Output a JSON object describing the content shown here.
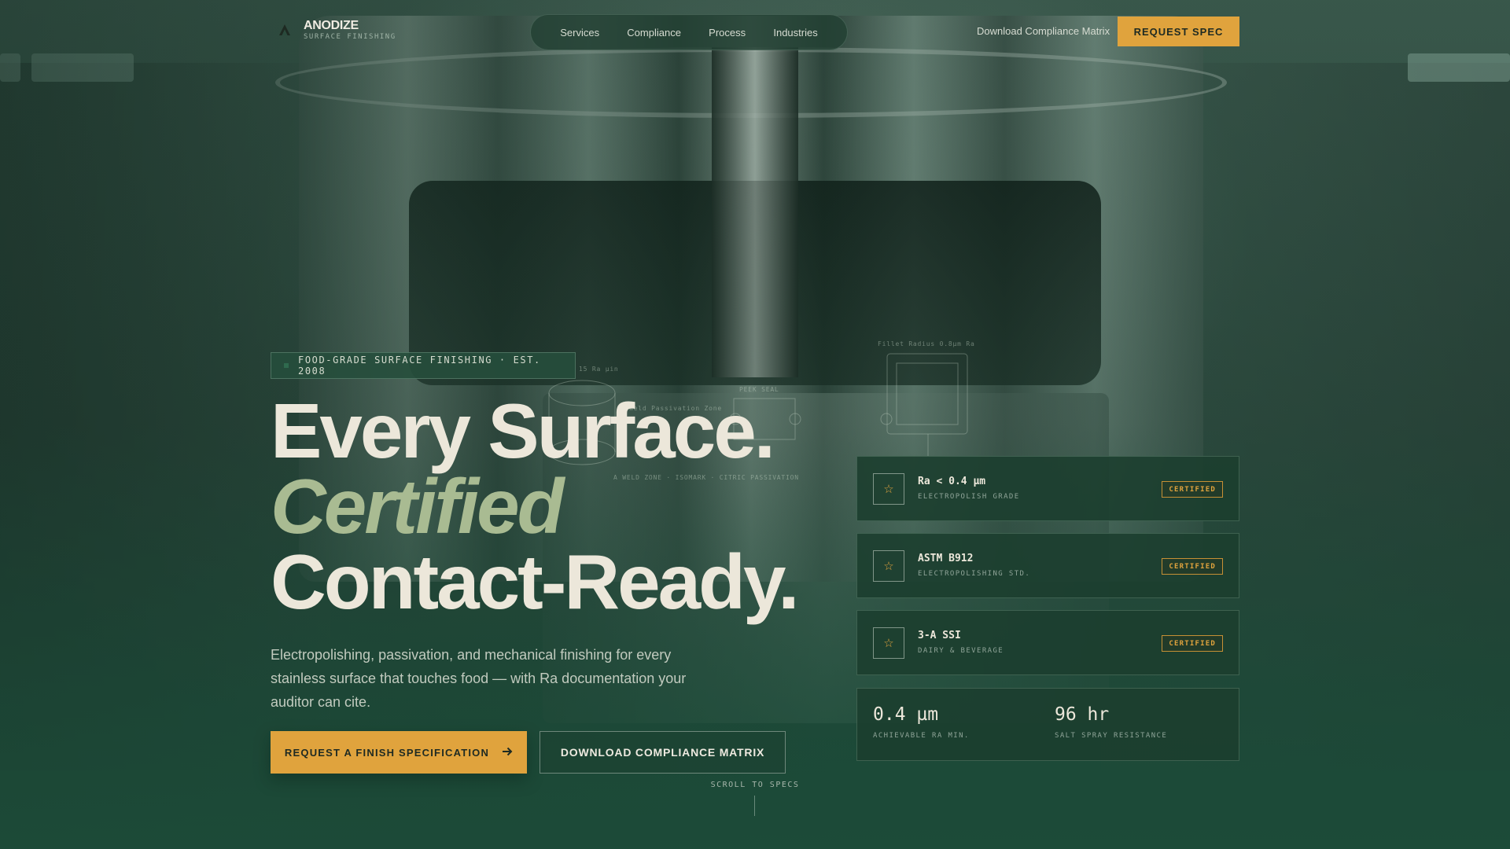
{
  "brand": {
    "name": "ANODIZE",
    "tagline": "SURFACE FINISHING",
    "icon": "triangle-logo-icon"
  },
  "nav": {
    "items": [
      {
        "label": "Services"
      },
      {
        "label": "Compliance"
      },
      {
        "label": "Process"
      },
      {
        "label": "Industries"
      }
    ],
    "matrix_link": "Download Compliance Matrix",
    "spec_button": "REQUEST SPEC"
  },
  "hero": {
    "eyebrow": "FOOD-GRADE SURFACE FINISHING · EST. 2008",
    "headline_line1": "Every Surface.",
    "headline_line2": "Certified",
    "headline_line3": "Contact-Ready.",
    "lede": "Electropolishing, passivation, and mechanical finishing for every stainless surface that touches food — with Ra documentation your auditor can cite.",
    "cta_primary": "REQUEST A FINISH SPECIFICATION",
    "cta_primary_icon": "arrow-right-icon",
    "cta_secondary": "DOWNLOAD COMPLIANCE MATRIX",
    "scroll_hint": "SCROLL TO SPECS"
  },
  "diagram_labels": {
    "a": "15 Ra µin",
    "b": "Weld Passivation Zone",
    "c": "PEEK SEAL",
    "d": "Fillet Radius 0.8µm Ra",
    "e": "A WELD ZONE · ISOMARK · CITRIC PASSIVATION"
  },
  "spec_cards": [
    {
      "title": "Ra < 0.4 µm",
      "subtitle": "ELECTROPOLISH GRADE",
      "badge": "CERTIFIED",
      "icon": "star-icon"
    },
    {
      "title": "ASTM B912",
      "subtitle": "ELECTROPOLISHING STD.",
      "badge": "CERTIFIED",
      "icon": "star-icon"
    },
    {
      "title": "3-A SSI",
      "subtitle": "DAIRY & BEVERAGE",
      "badge": "CERTIFIED",
      "icon": "star-icon"
    }
  ],
  "stats": [
    {
      "value": "0.4 µm",
      "label": "ACHIEVABLE RA MIN."
    },
    {
      "value": "96 hr",
      "label": "SALT SPRAY RESISTANCE"
    }
  ],
  "colors": {
    "accent": "#e0a33d",
    "background": "#29463a",
    "headline": "#ece7da",
    "italic_accent": "#a9bb92",
    "panel": "#1c3e2f"
  }
}
